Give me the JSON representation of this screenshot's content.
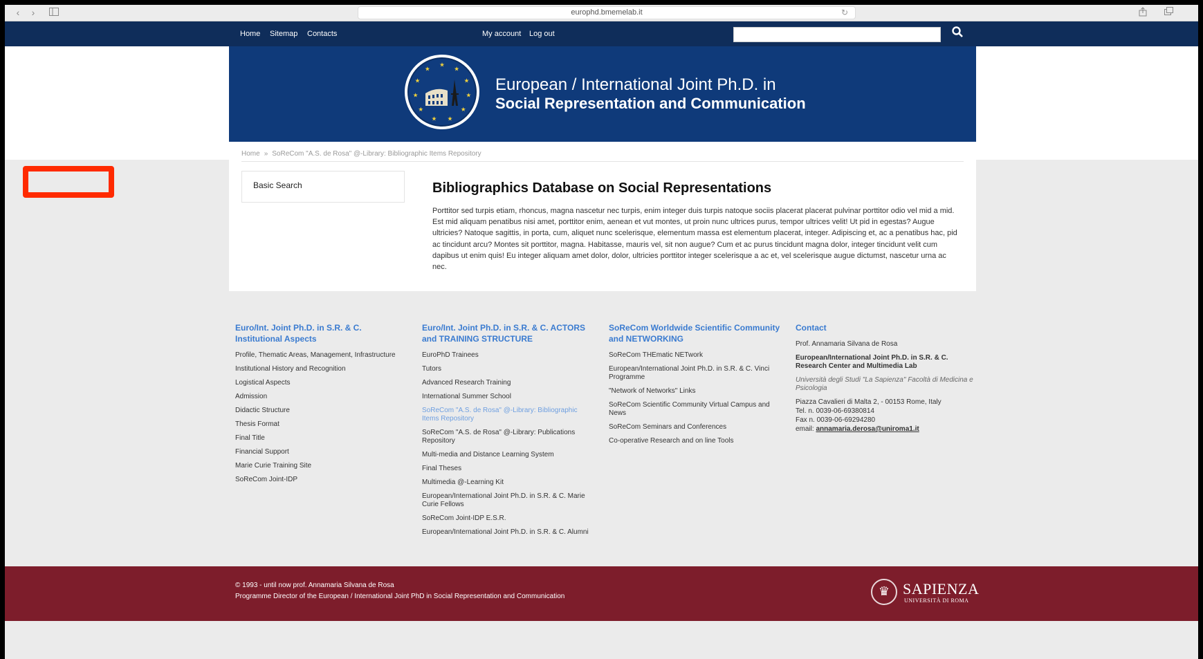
{
  "browser": {
    "url": "europhd.bmemelab.it",
    "back_icon": "chevron-left-icon",
    "forward_icon": "chevron-right-icon",
    "sidebar_icon": "sidebar-icon",
    "reload_icon": "reload-icon",
    "share_icon": "share-icon",
    "tabs_icon": "tabs-icon"
  },
  "topnav": {
    "home": "Home",
    "sitemap": "Sitemap",
    "contacts": "Contacts",
    "my_account": "My account",
    "log_out": "Log out",
    "search_placeholder": "",
    "search_icon": "search-icon"
  },
  "banner": {
    "line1": "European / International Joint Ph.D. in",
    "line2": "Social Representation and Communication"
  },
  "breadcrumb": {
    "home": "Home",
    "separator": "»",
    "current": "SoReCom \"A.S. de Rosa\" @-Library: Bibliographic Items Repository"
  },
  "sidebar": {
    "basic_search": "Basic Search"
  },
  "main": {
    "title": "Bibliographics Database on Social Representations",
    "body": "Porttitor sed turpis etiam, rhoncus, magna nascetur nec turpis, enim integer duis turpis natoque sociis placerat placerat pulvinar porttitor odio vel mid a mid. Est mid aliquam penatibus nisi amet, porttitor enim, aenean et vut montes, ut proin nunc ultrices purus, tempor ultrices velit! Ut pid in egestas? Augue ultricies? Natoque sagittis, in porta, cum, aliquet nunc scelerisque, elementum massa est elementum placerat, integer. Adipiscing et, ac a penatibus hac, pid ac tincidunt arcu? Montes sit porttitor, magna. Habitasse, mauris vel, sit non augue? Cum et ac purus tincidunt magna dolor, integer tincidunt velit cum dapibus ut enim quis! Eu integer aliquam amet dolor, dolor, ultricies porttitor integer scelerisque a ac et, vel scelerisque augue dictumst, nascetur urna ac nec."
  },
  "footer": {
    "col1": {
      "heading": "Euro/Int. Joint Ph.D. in S.R. & C. Institutional Aspects",
      "items": [
        "Profile, Thematic Areas, Management, Infrastructure",
        "Institutional History and Recognition",
        "Logistical Aspects",
        "Admission",
        "Didactic Structure",
        "Thesis Format",
        "Final Title",
        "Financial Support",
        "Marie Curie Training Site",
        "SoReCom Joint-IDP"
      ]
    },
    "col2": {
      "heading": "Euro/Int. Joint Ph.D. in S.R. & C. ACTORS and TRAINING STRUCTURE",
      "items": [
        "EuroPhD Trainees",
        "Tutors",
        "Advanced Research Training",
        "International Summer School",
        "SoReCom \"A.S. de Rosa\" @-Library: Bibliographic Items Repository",
        "SoReCom \"A.S. de Rosa\" @-Library: Publications Repository",
        "Multi-media and Distance Learning System",
        "Final Theses",
        "Multimedia @-Learning Kit",
        "European/International Joint Ph.D. in S.R. & C. Marie Curie Fellows",
        "SoReCom Joint-IDP E.S.R.",
        "European/International Joint Ph.D. in S.R. & C. Alumni"
      ]
    },
    "col3": {
      "heading": "SoReCom Worldwide Scientific Community and NETWORKING",
      "items": [
        "SoReCom THEmatic NETwork",
        "European/International Joint Ph.D. in S.R. & C. Vinci Programme",
        "\"Network of Networks\" Links",
        "SoReCom Scientific Community Virtual Campus and News",
        "SoReCom Seminars and Conferences",
        "Co-operative Research and on line Tools"
      ]
    },
    "col4": {
      "heading": "Contact",
      "name": "Prof. Annamaria Silvana de Rosa",
      "center": "European/International Joint Ph.D. in S.R. & C. Research Center and Multimedia Lab",
      "university": "Università degli Studi \"La Sapienza\" Facoltà di Medicina e Psicologia",
      "address": "Piazza Cavalieri di Malta 2, - 00153 Rome, Italy",
      "tel": "Tel. n. 0039-06-69380814",
      "fax": "Fax n. 0039-06-69294280",
      "email_label": "email:",
      "email": "annamaria.derosa@uniroma1.it"
    }
  },
  "bottom": {
    "copyright": "© 1993 - until now prof. Annamaria Silvana de Rosa",
    "director": "Programme Director of the European / International Joint PhD in Social Representation and Communication",
    "sapienza": "SAPIENZA",
    "sapienza_sub": "UNIVERSITÀ DI ROMA"
  }
}
